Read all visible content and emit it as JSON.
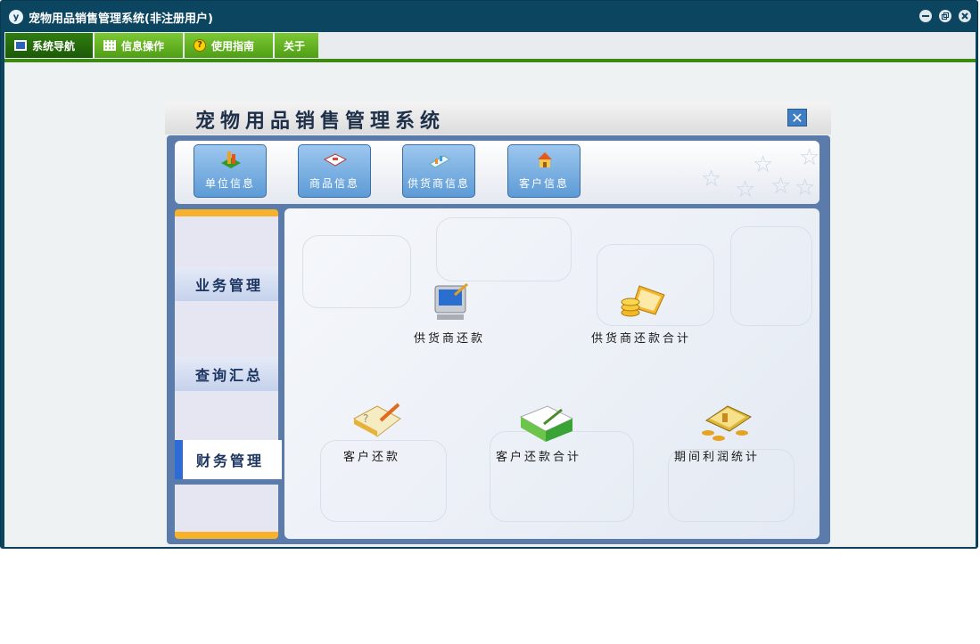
{
  "window": {
    "title": "宠物用品销售管理系统(非注册用户)",
    "app_icon_glyph": "y",
    "controls": [
      "minimize-icon",
      "restore-icon",
      "close-icon"
    ]
  },
  "menu": {
    "items": [
      {
        "label": "系统导航",
        "icon": "monitor-icon",
        "active": true
      },
      {
        "label": "信息操作",
        "icon": "grid-icon",
        "active": false
      },
      {
        "label": "使用指南",
        "icon": "help-icon",
        "active": false
      },
      {
        "label": "关于",
        "icon": "",
        "active": false
      }
    ]
  },
  "panel": {
    "title": "宠物用品销售管理系统",
    "close_glyph": "✕",
    "toolbar": [
      {
        "label": "单位信息",
        "icon": "organization-chart-icon"
      },
      {
        "label": "商品信息",
        "icon": "product-book-icon"
      },
      {
        "label": "供货商信息",
        "icon": "supplier-icon"
      },
      {
        "label": "客户信息",
        "icon": "customer-house-icon"
      }
    ],
    "sidebar": [
      {
        "label": "业务管理",
        "active": false
      },
      {
        "label": "查询汇总",
        "active": false
      },
      {
        "label": "财务管理",
        "active": true
      }
    ],
    "functions": [
      {
        "label": "供货商还款",
        "icon": "computer-icon"
      },
      {
        "label": "供货商还款合计",
        "icon": "coins-laptop-icon"
      },
      {
        "label": "客户还款",
        "icon": "notebook-pencil-icon"
      },
      {
        "label": "客户还款合计",
        "icon": "green-book-icon"
      },
      {
        "label": "期间利润统计",
        "icon": "gold-coins-icon"
      }
    ]
  },
  "colors": {
    "title_bar": "#0c4560",
    "menu_green": "#5aaa1a",
    "menu_active": "#2a6f0f",
    "sidebar_accent": "#f7b12b",
    "active_marker": "#2f6bd6"
  }
}
